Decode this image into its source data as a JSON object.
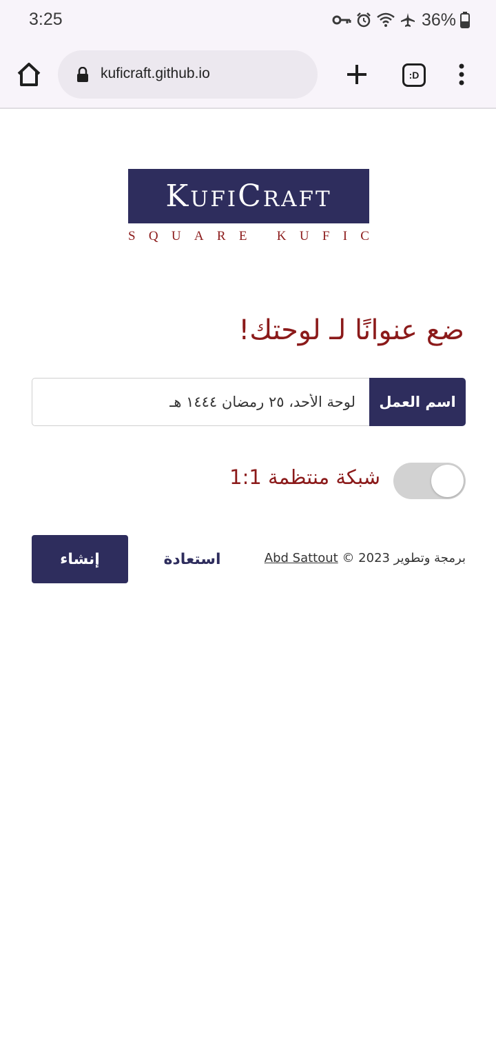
{
  "status_bar": {
    "time": "3:25",
    "battery": "36%",
    "icons": [
      "key-icon",
      "alarm-icon",
      "wifi-icon",
      "airplane-icon",
      "battery-icon"
    ]
  },
  "browser": {
    "url": "kuficraft.github.io",
    "tabs_label": ":D",
    "icons": [
      "home-icon",
      "lock-icon",
      "plus-icon",
      "tabs-icon",
      "more-icon"
    ]
  },
  "logo": {
    "title": "KufiCraft",
    "subtitle": "SQUARE KUFIC"
  },
  "heading": "ضع عنوانًا لـ لوحتك!",
  "form": {
    "label": "اسم العمل",
    "value": "لوحة الأحد، ٢٥ رمضان ١٤٤٤ هـ"
  },
  "toggle": {
    "label": "شبكة منتظمة 1:1",
    "checked": false
  },
  "actions": {
    "create": "إنشاء",
    "restore": "استعادة"
  },
  "credit": {
    "prefix": "برمجة وتطوير 2023 ©",
    "author": "Abd Sattout"
  },
  "colors": {
    "primary": "#2e2d5d",
    "accent": "#8b1a1a"
  }
}
